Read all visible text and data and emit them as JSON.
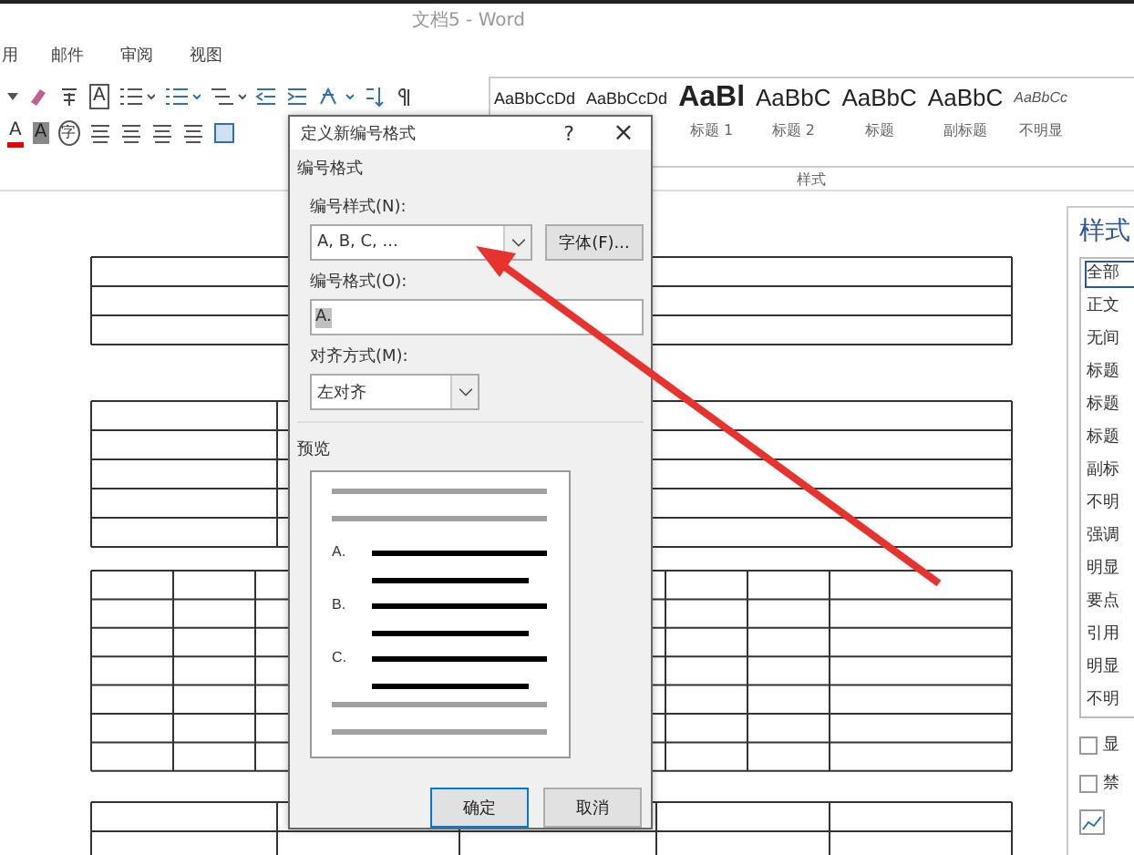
{
  "window": {
    "title": "文档5 - Word"
  },
  "tabs": [
    {
      "label": "用",
      "selected": false
    },
    {
      "label": "邮件",
      "selected": false
    },
    {
      "label": "审阅",
      "selected": false
    },
    {
      "label": "视图",
      "selected": false
    }
  ],
  "ribbon": {
    "glyphs": {
      "char_border": "A",
      "font_color": "A",
      "shading": "A",
      "enclosed": "字"
    },
    "styles": [
      {
        "sample": "AaBbCcDd",
        "kind": "normal"
      },
      {
        "sample": "AaBbCcDd",
        "kind": "normal"
      },
      {
        "sample": "AaBl",
        "label": "标题 1",
        "kind": "heading"
      },
      {
        "sample": "AaBbC",
        "label": "标题 2",
        "kind": "large"
      },
      {
        "sample": "AaBbC",
        "label": "标题",
        "kind": "large"
      },
      {
        "sample": "AaBbC",
        "label": "副标题",
        "kind": "large"
      },
      {
        "sample": "AaBbCc",
        "label": "不明显",
        "kind": "italic"
      }
    ],
    "group_label": "样式"
  },
  "styles_pane": {
    "title": "样式",
    "items": [
      {
        "label": "全部",
        "selected": true
      },
      {
        "label": "正文",
        "selected": false
      },
      {
        "label": "无间",
        "selected": false
      },
      {
        "label": "标题",
        "selected": false
      },
      {
        "label": "标题",
        "selected": false
      },
      {
        "label": "标题",
        "selected": false
      },
      {
        "label": "副标",
        "selected": false
      },
      {
        "label": "不明",
        "selected": false
      },
      {
        "label": "强调",
        "selected": false
      },
      {
        "label": "明显",
        "selected": false
      },
      {
        "label": "要点",
        "selected": false
      },
      {
        "label": "引用",
        "selected": false
      },
      {
        "label": "明显",
        "selected": false
      },
      {
        "label": "不明",
        "selected": false
      }
    ],
    "options": [
      {
        "label": "显",
        "checked": false
      },
      {
        "label": "禁",
        "checked": false
      }
    ]
  },
  "dialog": {
    "title": "定义新编号格式",
    "help": "?",
    "close": "×",
    "group": "编号格式",
    "style_label": "编号样式(N):",
    "style_value": "A, B, C, ...",
    "font_button": "字体(F)...",
    "format_label": "编号格式(O):",
    "format_value": "A.",
    "align_label": "对齐方式(M):",
    "align_value": "左对齐",
    "preview_label": "预览",
    "preview_items": [
      "A.",
      "B.",
      "C."
    ],
    "buttons": [
      {
        "label": "确定",
        "kind": "default"
      },
      {
        "label": "取消",
        "kind": "normal"
      }
    ]
  }
}
